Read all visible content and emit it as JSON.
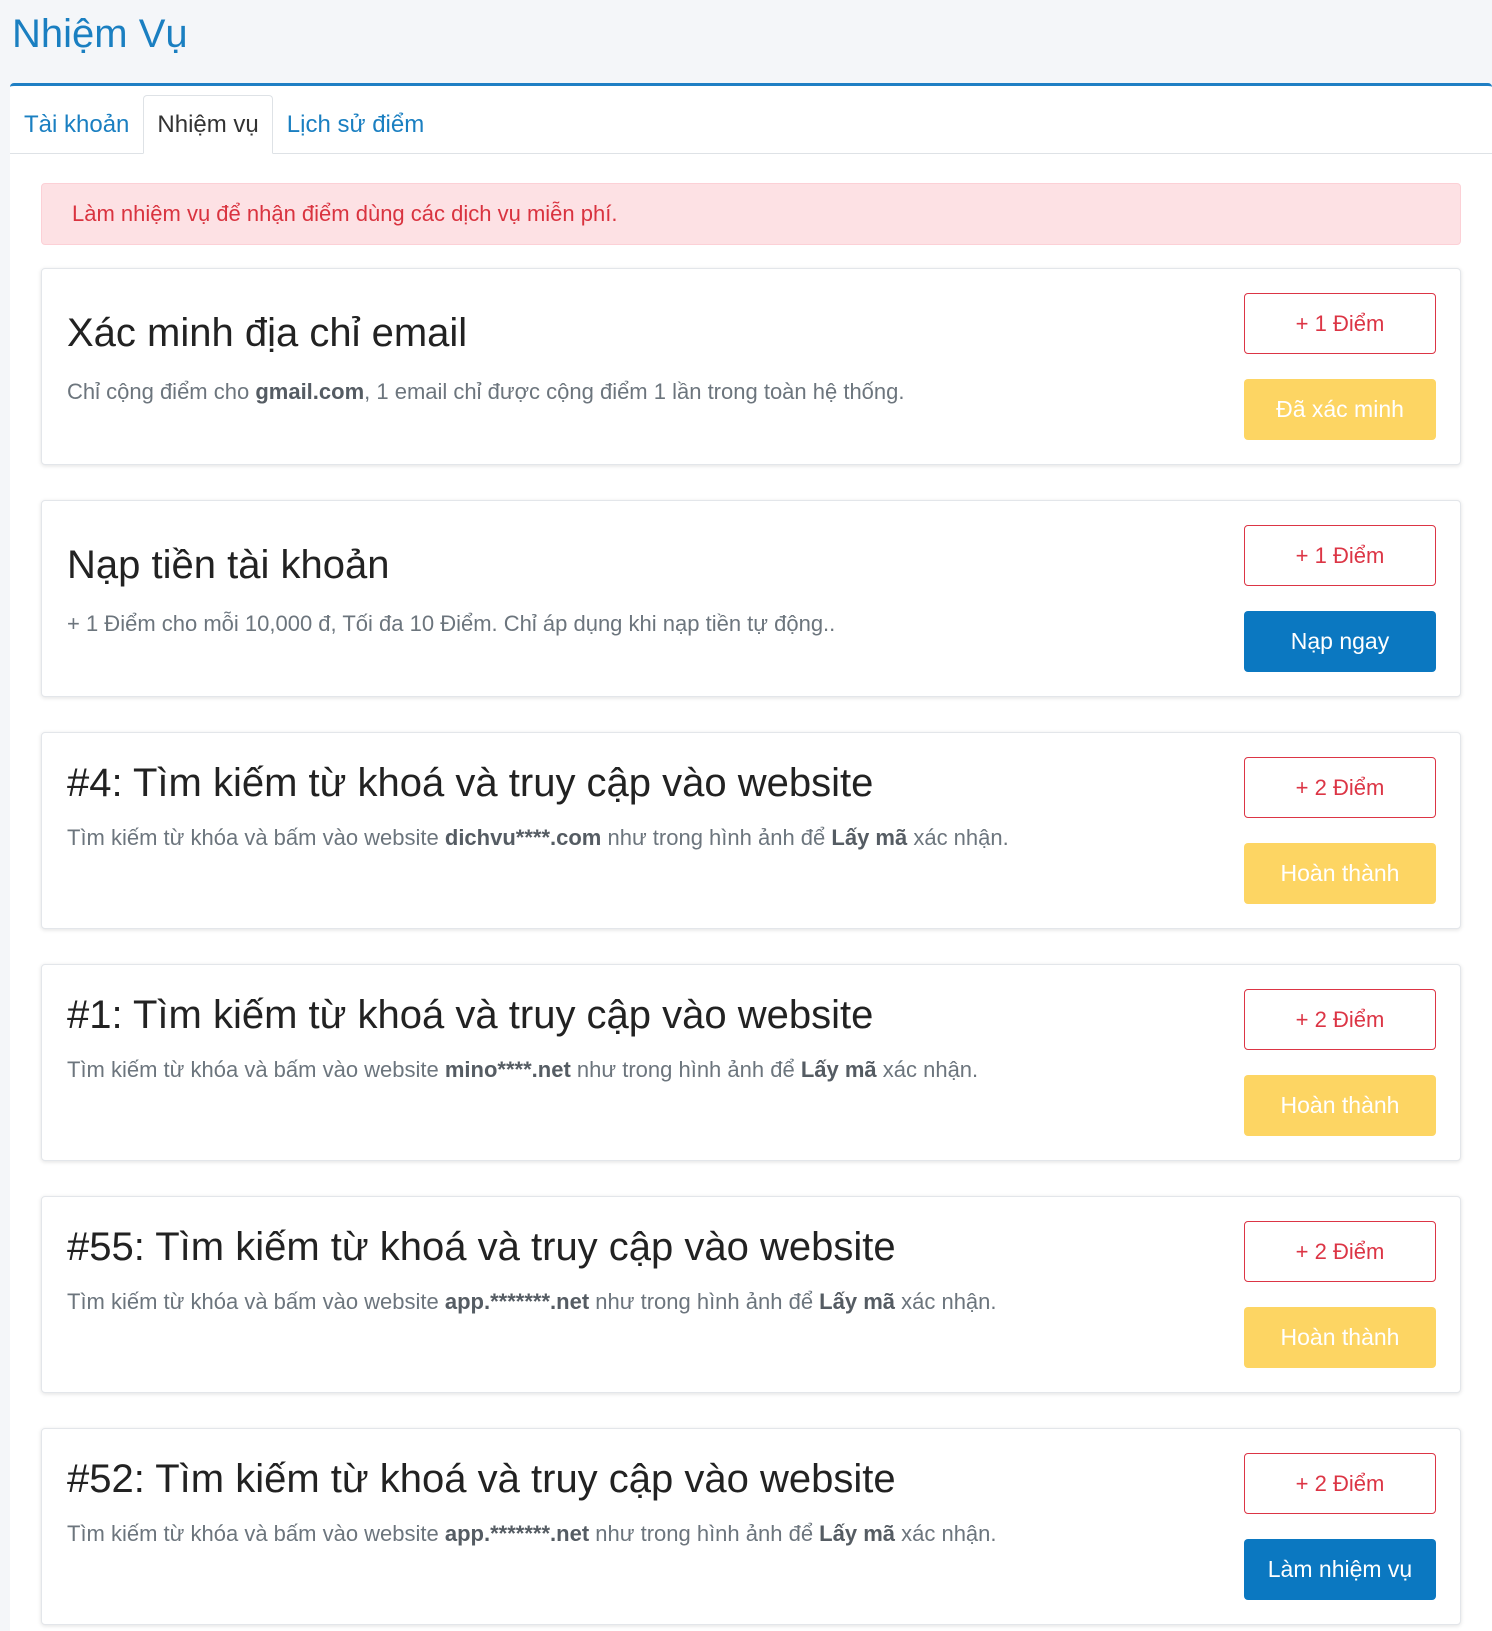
{
  "page": {
    "title": "Nhiệm Vụ"
  },
  "tabs": [
    {
      "label": "Tài khoản",
      "active": false
    },
    {
      "label": "Nhiệm vụ",
      "active": true
    },
    {
      "label": "Lịch sử điểm",
      "active": false
    }
  ],
  "alert": {
    "text": "Làm nhiệm vụ để nhận điểm dùng các dịch vụ miễn phí."
  },
  "tasks": [
    {
      "title": "Xác minh địa chỉ email",
      "desc_before": "Chỉ cộng điểm cho ",
      "desc_bold1": "gmail.com",
      "desc_middle": ", 1 email chỉ được cộng điểm 1 lần trong toàn hệ thống.",
      "desc_bold2": "",
      "desc_after": "",
      "points": "+ 1 Điểm",
      "action": "Đã xác minh",
      "action_style": "warning"
    },
    {
      "title": "Nạp tiền tài khoản",
      "desc_before": "+ 1 Điểm cho mỗi 10,000 đ, Tối đa 10 Điểm. Chỉ áp dụng khi nạp tiền tự động..",
      "desc_bold1": "",
      "desc_middle": "",
      "desc_bold2": "",
      "desc_after": "",
      "points": "+ 1 Điểm",
      "action": "Nạp ngay",
      "action_style": "primary"
    },
    {
      "title": "#4: Tìm kiếm từ khoá và truy cập vào website",
      "desc_before": "Tìm kiếm từ khóa và bấm vào website ",
      "desc_bold1": "dichvu****.com",
      "desc_middle": " như trong hình ảnh để ",
      "desc_bold2": "Lấy mã",
      "desc_after": " xác nhận.",
      "points": "+ 2 Điểm",
      "action": "Hoàn thành",
      "action_style": "warning"
    },
    {
      "title": "#1: Tìm kiếm từ khoá và truy cập vào website",
      "desc_before": "Tìm kiếm từ khóa và bấm vào website ",
      "desc_bold1": "mino****.net",
      "desc_middle": " như trong hình ảnh để ",
      "desc_bold2": "Lấy mã",
      "desc_after": " xác nhận.",
      "points": "+ 2 Điểm",
      "action": "Hoàn thành",
      "action_style": "warning"
    },
    {
      "title": "#55: Tìm kiếm từ khoá và truy cập vào website",
      "desc_before": "Tìm kiếm từ khóa và bấm vào website ",
      "desc_bold1": "app.*******.net",
      "desc_middle": " như trong hình ảnh để ",
      "desc_bold2": "Lấy mã",
      "desc_after": " xác nhận.",
      "points": "+ 2 Điểm",
      "action": "Hoàn thành",
      "action_style": "warning"
    },
    {
      "title": "#52: Tìm kiếm từ khoá và truy cập vào website",
      "desc_before": "Tìm kiếm từ khóa và bấm vào website ",
      "desc_bold1": "app.*******.net",
      "desc_middle": " như trong hình ảnh để ",
      "desc_bold2": "Lấy mã",
      "desc_after": " xác nhận.",
      "points": "+ 2 Điểm",
      "action": "Làm nhiệm vụ",
      "action_style": "primary"
    }
  ]
}
